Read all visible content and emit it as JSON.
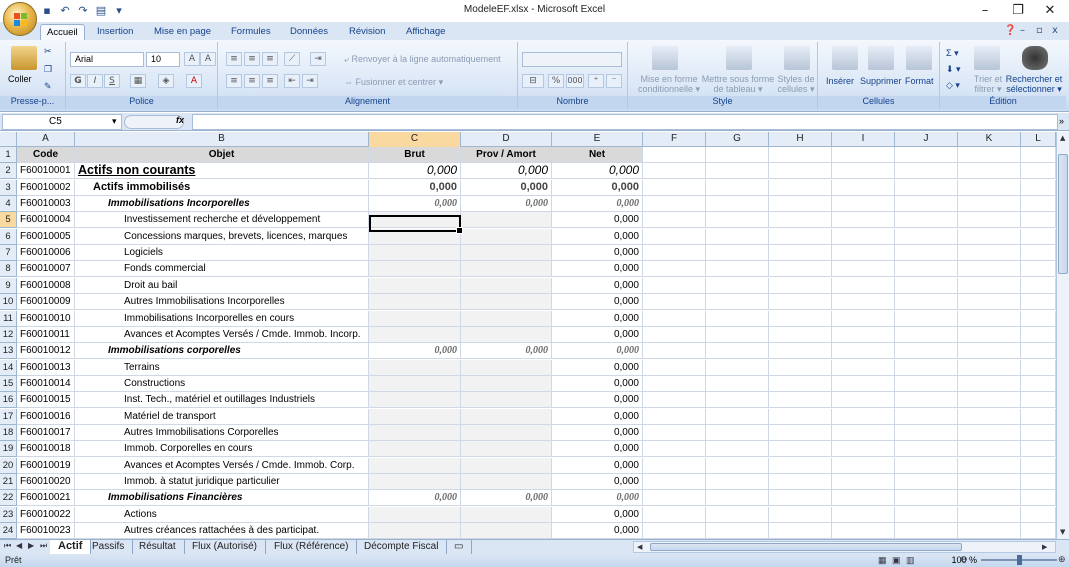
{
  "window": {
    "title": "ModeleEF.xlsx - Microsoft Excel",
    "minimize": "–",
    "restore": "❐",
    "close": "✕"
  },
  "quick_access": {
    "dropdown": "▾"
  },
  "ribbon_tabs": [
    "Accueil",
    "Insertion",
    "Mise en page",
    "Formules",
    "Données",
    "Révision",
    "Affichage"
  ],
  "ribbon": {
    "clipboard": {
      "label": "Presse-p...",
      "paste": "Coller"
    },
    "font": {
      "label": "Police",
      "name": "Arial",
      "size": "10",
      "bold": "G",
      "italic": "I",
      "underline": "S"
    },
    "alignment": {
      "label": "Alignement",
      "wrap": "Renvoyer à la ligne automatiquement",
      "merge": "Fusionner et centrer"
    },
    "number": {
      "label": "Nombre",
      "format": "",
      "percent": "%",
      "thousands": "000"
    },
    "style": {
      "label": "Style",
      "conditional": [
        "Mise en forme",
        "conditionnelle"
      ],
      "table": [
        "Mettre sous forme",
        "de tableau"
      ],
      "cell_styles": [
        "Styles de",
        "cellules"
      ]
    },
    "cells": {
      "label": "Cellules",
      "insert": "Insérer",
      "delete": "Supprimer",
      "format": "Format"
    },
    "editing": {
      "label": "Édition",
      "sort": [
        "Trier et",
        "filtrer"
      ],
      "find": [
        "Rechercher et",
        "sélectionner"
      ]
    }
  },
  "formula_bar": {
    "name_box": "C5",
    "fx": "fx",
    "value": ""
  },
  "columns": [
    {
      "id": "A",
      "label": "A"
    },
    {
      "id": "B",
      "label": "B"
    },
    {
      "id": "C",
      "label": "C"
    },
    {
      "id": "D",
      "label": "D"
    },
    {
      "id": "E",
      "label": "E"
    },
    {
      "id": "F",
      "label": "F"
    },
    {
      "id": "G",
      "label": "G"
    },
    {
      "id": "H",
      "label": "H"
    },
    {
      "id": "I",
      "label": "I"
    },
    {
      "id": "J",
      "label": "J"
    },
    {
      "id": "K",
      "label": "K"
    },
    {
      "id": "L",
      "label": "L"
    }
  ],
  "selected_cell": "C5",
  "rows": [
    {
      "n": "1",
      "code": "Code",
      "objet": "Objet",
      "brut": "Brut",
      "prov": "Prov / Amort",
      "net": "Net",
      "style": "hdr"
    },
    {
      "n": "2",
      "code": "F60010001",
      "objet": "Actifs non courants",
      "brut": "0,000",
      "prov": "0,000",
      "net": "0,000",
      "style": "l1"
    },
    {
      "n": "3",
      "code": "F60010002",
      "objet": "Actifs immobilisés",
      "brut": "0,000",
      "prov": "0,000",
      "net": "0,000",
      "style": "l2"
    },
    {
      "n": "4",
      "code": "F60010003",
      "objet": "Immobilisations Incorporelles",
      "brut": "0,000",
      "prov": "0,000",
      "net": "0,000",
      "style": "l3"
    },
    {
      "n": "5",
      "code": "F60010004",
      "objet": "Investissement recherche et développement",
      "brut": "",
      "prov": "",
      "net": "0,000",
      "style": "l4"
    },
    {
      "n": "6",
      "code": "F60010005",
      "objet": "Concessions marques, brevets, licences, marques",
      "brut": "",
      "prov": "",
      "net": "0,000",
      "style": "l4"
    },
    {
      "n": "7",
      "code": "F60010006",
      "objet": "Logiciels",
      "brut": "",
      "prov": "",
      "net": "0,000",
      "style": "l4"
    },
    {
      "n": "8",
      "code": "F60010007",
      "objet": "Fonds commercial",
      "brut": "",
      "prov": "",
      "net": "0,000",
      "style": "l4"
    },
    {
      "n": "9",
      "code": "F60010008",
      "objet": "Droit au bail",
      "brut": "",
      "prov": "",
      "net": "0,000",
      "style": "l4"
    },
    {
      "n": "10",
      "code": "F60010009",
      "objet": "Autres Immobilisations Incorporelles",
      "brut": "",
      "prov": "",
      "net": "0,000",
      "style": "l4"
    },
    {
      "n": "11",
      "code": "F60010010",
      "objet": "Immobilisations Incorporelles en cours",
      "brut": "",
      "prov": "",
      "net": "0,000",
      "style": "l4"
    },
    {
      "n": "12",
      "code": "F60010011",
      "objet": "Avances et Acomptes Versés / Cmde. Immob. Incorp.",
      "brut": "",
      "prov": "",
      "net": "0,000",
      "style": "l4"
    },
    {
      "n": "13",
      "code": "F60010012",
      "objet": "Immobilisations corporelles",
      "brut": "0,000",
      "prov": "0,000",
      "net": "0,000",
      "style": "l3"
    },
    {
      "n": "14",
      "code": "F60010013",
      "objet": "Terrains",
      "brut": "",
      "prov": "",
      "net": "0,000",
      "style": "l4"
    },
    {
      "n": "15",
      "code": "F60010014",
      "objet": "Constructions",
      "brut": "",
      "prov": "",
      "net": "0,000",
      "style": "l4"
    },
    {
      "n": "16",
      "code": "F60010015",
      "objet": "Inst. Tech., matériel et outillages Industriels",
      "brut": "",
      "prov": "",
      "net": "0,000",
      "style": "l4"
    },
    {
      "n": "17",
      "code": "F60010016",
      "objet": "Matériel de transport",
      "brut": "",
      "prov": "",
      "net": "0,000",
      "style": "l4"
    },
    {
      "n": "18",
      "code": "F60010017",
      "objet": "Autres Immobilisations Corporelles",
      "brut": "",
      "prov": "",
      "net": "0,000",
      "style": "l4"
    },
    {
      "n": "19",
      "code": "F60010018",
      "objet": "Immob. Corporelles en cours",
      "brut": "",
      "prov": "",
      "net": "0,000",
      "style": "l4"
    },
    {
      "n": "20",
      "code": "F60010019",
      "objet": "Avances et Acomptes Versés / Cmde. Immob. Corp.",
      "brut": "",
      "prov": "",
      "net": "0,000",
      "style": "l4"
    },
    {
      "n": "21",
      "code": "F60010020",
      "objet": "Immob. à statut juridique particulier",
      "brut": "",
      "prov": "",
      "net": "0,000",
      "style": "l4"
    },
    {
      "n": "22",
      "code": "F60010021",
      "objet": "Immobilisations Financières",
      "brut": "0,000",
      "prov": "0,000",
      "net": "0,000",
      "style": "l3"
    },
    {
      "n": "23",
      "code": "F60010022",
      "objet": "Actions",
      "brut": "",
      "prov": "",
      "net": "0,000",
      "style": "l4"
    },
    {
      "n": "24",
      "code": "F60010023",
      "objet": "Autres créances rattachées à des participat.",
      "brut": "",
      "prov": "",
      "net": "0,000",
      "style": "l4"
    }
  ],
  "sheet_tabs": [
    "Actif",
    "Passifs",
    "Résultat",
    "Flux (Autorisé)",
    "Flux (Référence)",
    "Décompte Fiscal"
  ],
  "active_sheet": "Actif",
  "status": {
    "ready": "Prêt",
    "zoom": "100 %",
    "zoom_level_percent": 100
  }
}
